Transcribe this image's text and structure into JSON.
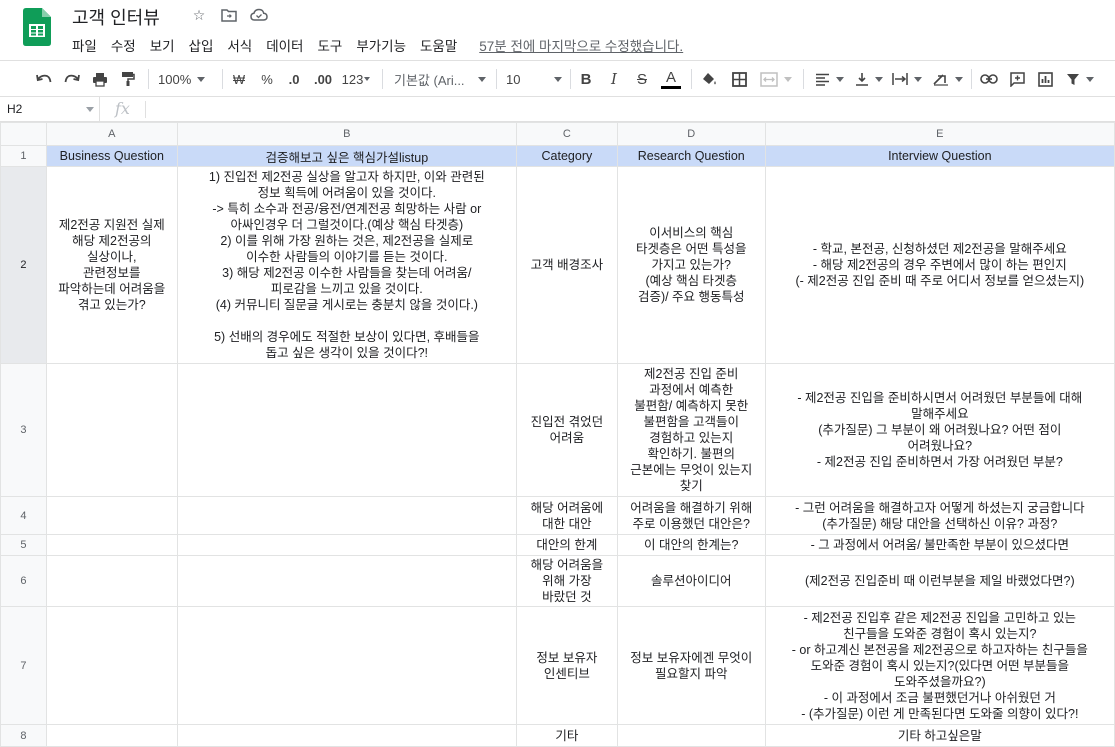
{
  "app": {
    "doc_title": "고객 인터뷰",
    "menu": [
      "파일",
      "수정",
      "보기",
      "삽입",
      "서식",
      "데이터",
      "도구",
      "부가기능",
      "도움말"
    ],
    "last_edit": "57분 전에 마지막으로 수정했습니다."
  },
  "toolbar": {
    "zoom": "100%",
    "currency": "₩",
    "percent": "%",
    "dec_decrease": ".0",
    "dec_increase": ".00",
    "more_formats": "123",
    "font": "기본값 (Ari...",
    "font_size": "10",
    "bold": "B",
    "italic": "I",
    "strike": "S",
    "text_color": "A"
  },
  "formula_bar": {
    "cell_ref": "H2",
    "fx": "fx",
    "value": ""
  },
  "sheet": {
    "columns": [
      "A",
      "B",
      "C",
      "D",
      "E"
    ],
    "rows": [
      {
        "num": "1",
        "cells": [
          "Business Question",
          "검증해보고 싶은 핵심가설listup",
          "Category",
          "Research Question",
          "Interview Question"
        ]
      },
      {
        "num": "2",
        "cells": [
          "제2전공 지원전 실제\n해당 제2전공의\n실상이나,\n관련정보를\n파악하는데 어려움을\n겪고 있는가?",
          "1) 진입전 제2전공 실상을 알고자 하지만, 이와 관련된\n정보 획득에 어려움이 있을 것이다.\n-> 특히 소수과 전공/융전/연계전공 희망하는 사람 or\n아싸인경우 더 그럴것이다.(예상 핵심 타겟층)\n2) 이를 위해 가장 원하는 것은, 제2전공을 실제로\n이수한 사람들의 이야기를 듣는 것이다.\n3) 해당 제2전공 이수한 사람들을 찾는데 어려움/\n피로감을 느끼고 있을 것이다.\n(4) 커뮤니티 질문글 게시로는 충분치 않을 것이다.)\n\n5) 선배의 경우에도 적절한 보상이 있다면, 후배들을\n돕고 싶은 생각이 있을 것이다?!",
          "고객 배경조사",
          "이서비스의 핵심\n타겟층은 어떤 특성을\n가지고 있는가?\n(예상 핵심 타겟층\n검증)/ 주요 행동특성",
          "- 학교, 본전공, 신청하셨던 제2전공을 말해주세요\n- 해당 제2전공의 경우 주변에서 많이 하는 편인지\n(- 제2전공 진입 준비 때 주로 어디서 정보를 얻으셨는지)"
        ]
      },
      {
        "num": "3",
        "cells": [
          "",
          "",
          "진입전 겪었던\n어려움",
          "제2전공 진입 준비\n과정에서 예측한\n불편함/ 예측하지 못한\n불편함을 고객들이\n경험하고 있는지\n확인하기. 불편의\n근본에는 무엇이 있는지\n찾기",
          "- 제2전공 진입을 준비하시면서 어려웠던 부분들에 대해\n말해주세요\n(추가질문) 그 부분이 왜 어려웠나요? 어떤 점이\n어려웠나요?\n- 제2전공 진입 준비하면서 가장 어려웠던 부분?"
        ]
      },
      {
        "num": "4",
        "cells": [
          "",
          "",
          "해당 어려움에\n대한 대안",
          "어려움을 해결하기 위해\n주로 이용했던 대안은?",
          "- 그런 어려움을 해결하고자 어떻게 하셨는지 궁금합니다\n(추가질문) 해당 대안을 선택하신 이유? 과정?"
        ]
      },
      {
        "num": "5",
        "cells": [
          "",
          "",
          "대안의 한계",
          "이 대안의 한계는?",
          "- 그 과정에서 어려움/ 불만족한 부분이 있으셨다면"
        ]
      },
      {
        "num": "6",
        "cells": [
          "",
          "",
          "해당 어려움을\n위해 가장\n바랐던 것",
          "솔루션아이디어",
          "(제2전공 진입준비 때 이런부분을 제일 바랬었다면?)"
        ]
      },
      {
        "num": "7",
        "cells": [
          "",
          "",
          "정보 보유자\n인센티브",
          "정보 보유자에겐 무엇이\n필요할지 파악",
          "- 제2전공 진입후 같은 제2전공 진입을 고민하고 있는\n친구들을 도와준 경험이 혹시 있는지?\n- or 하고계신 본전공을 제2전공으로 하고자하는 친구들을\n도와준 경험이 혹시 있는지?(있다면 어떤 부분들을\n도와주셨을까요?)\n- 이 과정에서 조금 불편했던거나 아쉬웠던 거\n- (추가질문) 이런 게 만족된다면 도와줄 의향이 있다?!"
        ]
      },
      {
        "num": "8",
        "cells": [
          "",
          "",
          "기타",
          "",
          "기타 하고싶은말"
        ]
      }
    ]
  },
  "colors": {
    "header_row_bg": "#c9daf8",
    "sheets_green": "#0f9d58"
  }
}
